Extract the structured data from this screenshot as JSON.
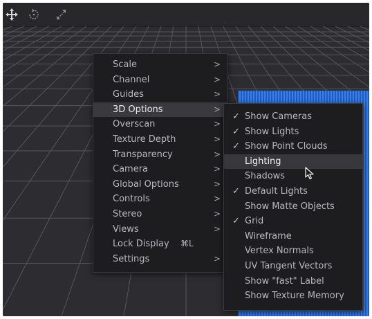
{
  "toolbar": {
    "icons": [
      "move-icon",
      "rotate-icon",
      "scale-icon"
    ]
  },
  "main_menu": {
    "items": [
      {
        "label": "Scale",
        "submenu": true
      },
      {
        "label": "Channel",
        "submenu": true
      },
      {
        "label": "Guides",
        "submenu": true
      },
      {
        "label": "3D Options",
        "submenu": true,
        "highlighted": true
      },
      {
        "label": "Overscan",
        "submenu": true
      },
      {
        "label": "Texture Depth",
        "submenu": true
      },
      {
        "label": "Transparency",
        "submenu": true
      },
      {
        "label": "Camera",
        "submenu": true
      },
      {
        "label": "Global Options",
        "submenu": true
      },
      {
        "label": "Controls",
        "submenu": true
      },
      {
        "label": "Stereo",
        "submenu": true
      },
      {
        "label": "Views",
        "submenu": true
      },
      {
        "label": "Lock Display",
        "shortcut": "⌘L"
      },
      {
        "label": "Settings",
        "submenu": true
      }
    ],
    "arrow": ">"
  },
  "submenu_3d": {
    "items": [
      {
        "label": "Show Cameras",
        "checked": true
      },
      {
        "label": "Show Lights",
        "checked": true
      },
      {
        "label": "Show Point Clouds",
        "checked": true
      },
      {
        "label": "Lighting",
        "checked": false,
        "hovered": true
      },
      {
        "label": "Shadows",
        "checked": false
      },
      {
        "label": "Default Lights",
        "checked": true
      },
      {
        "label": "Show Matte Objects",
        "checked": false
      },
      {
        "label": "Grid",
        "checked": true
      },
      {
        "label": "Wireframe",
        "checked": false
      },
      {
        "label": "Vertex Normals",
        "checked": false
      },
      {
        "label": "UV Tangent Vectors",
        "checked": false
      },
      {
        "label": "Show \"fast\" Label",
        "checked": false
      },
      {
        "label": "Show Texture Memory",
        "checked": false
      }
    ],
    "check_glyph": "✓"
  },
  "colors": {
    "viewport_bg": "#2d2d31",
    "menu_bg": "#1d1d20",
    "grid_line": "#5c5c62",
    "object_blue": "#2e73e6"
  }
}
